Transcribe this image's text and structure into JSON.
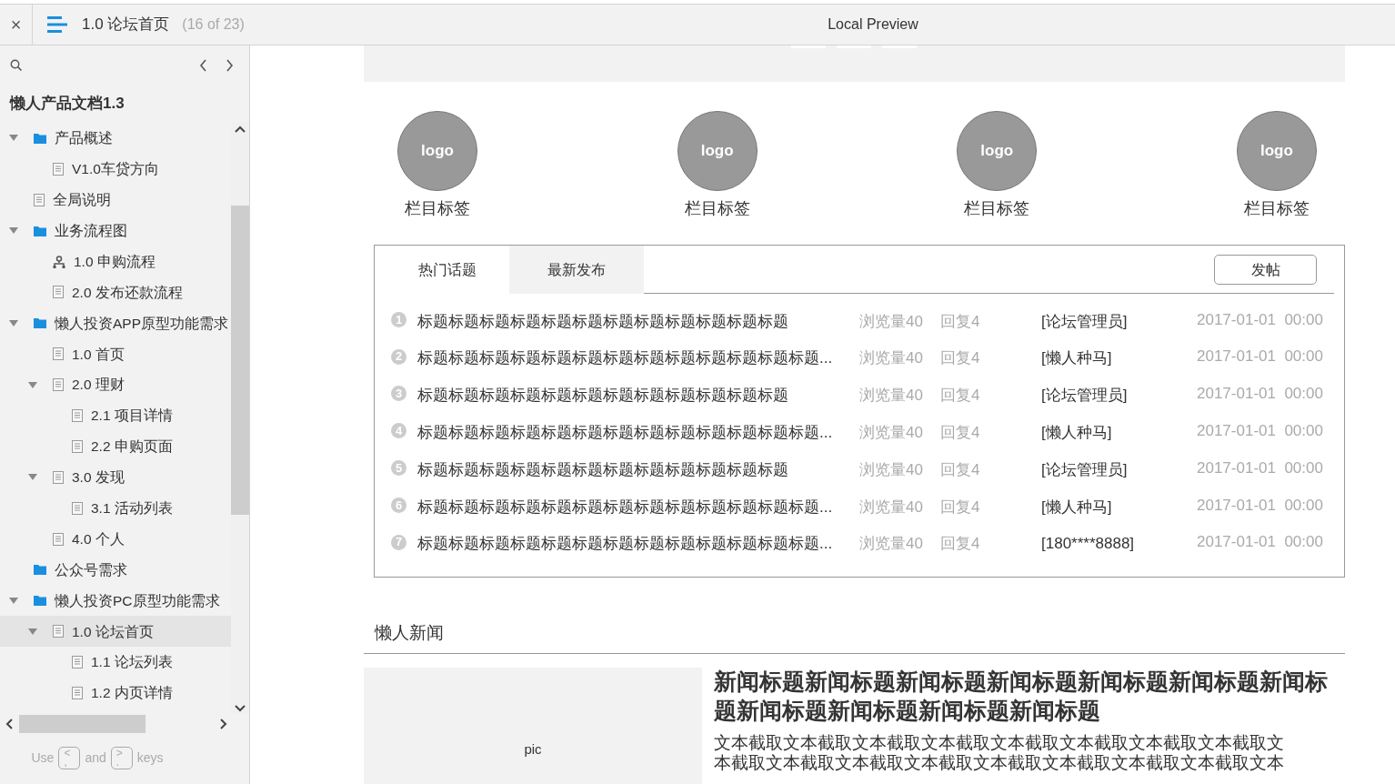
{
  "title_bar": {
    "close": "×",
    "page_title": "1.0 论坛首页",
    "page_count": "(16 of 23)",
    "preview_title": "Local Preview"
  },
  "sidebar": {
    "project_title": "懒人产品文档1.3",
    "items": [
      {
        "label": "产品概述",
        "kind": "folder",
        "expanded": true,
        "selected": false,
        "children": [
          {
            "label": "V1.0车贷方向",
            "kind": "page",
            "selected": false
          }
        ]
      },
      {
        "label": "全局说明",
        "kind": "page",
        "selected": false
      },
      {
        "label": "业务流程图",
        "kind": "folder",
        "expanded": true,
        "selected": false,
        "children": [
          {
            "label": "1.0 申购流程",
            "kind": "flow",
            "selected": false
          },
          {
            "label": "2.0 发布还款流程",
            "kind": "page",
            "selected": false
          }
        ]
      },
      {
        "label": "懒人投资APP原型功能需求",
        "kind": "folder",
        "expanded": true,
        "selected": false,
        "children": [
          {
            "label": "1.0 首页",
            "kind": "page",
            "selected": false
          },
          {
            "label": "2.0 理财",
            "kind": "page",
            "expanded": true,
            "selected": false,
            "children": [
              {
                "label": "2.1 项目详情",
                "kind": "page",
                "selected": false
              },
              {
                "label": "2.2 申购页面",
                "kind": "page",
                "selected": false
              }
            ]
          },
          {
            "label": "3.0 发现",
            "kind": "page",
            "expanded": true,
            "selected": false,
            "children": [
              {
                "label": "3.1 活动列表",
                "kind": "page",
                "selected": false
              }
            ]
          },
          {
            "label": "4.0 个人",
            "kind": "page",
            "selected": false
          }
        ]
      },
      {
        "label": "公众号需求",
        "kind": "folder",
        "selected": false
      },
      {
        "label": "懒人投资PC原型功能需求",
        "kind": "folder",
        "expanded": true,
        "selected": false,
        "children": [
          {
            "label": "1.0 论坛首页",
            "kind": "page",
            "expanded": true,
            "selected": true,
            "children": [
              {
                "label": "1.1 论坛列表",
                "kind": "page",
                "selected": false
              },
              {
                "label": "1.2 内页详情",
                "kind": "page",
                "selected": false
              }
            ]
          }
        ]
      }
    ],
    "footer": {
      "use": "Use",
      "key_prev": [
        "<",
        ","
      ],
      "and": "and",
      "key_next": [
        ">",
        "."
      ],
      "keys": "keys"
    }
  },
  "categories": [
    {
      "logo": "logo",
      "label": "栏目标签"
    },
    {
      "logo": "logo",
      "label": "栏目标签"
    },
    {
      "logo": "logo",
      "label": "栏目标签"
    },
    {
      "logo": "logo",
      "label": "栏目标签"
    }
  ],
  "forum": {
    "tabs": [
      {
        "label": "热门话题",
        "selected": false
      },
      {
        "label": "最新发布",
        "selected": true
      }
    ],
    "post_button": "发帖",
    "rows": [
      {
        "number": "1",
        "title": "标题标题标题标题标题标题标题标题标题标题标题标题",
        "views": "浏览量40",
        "replies": "回复4",
        "author": "[论坛管理员]",
        "time": "2017-01-01  00:00"
      },
      {
        "number": "2",
        "title": "标题标题标题标题标题标题标题标题标题标题标题标题标题...",
        "views": "浏览量40",
        "replies": "回复4",
        "author": "[懒人种马]",
        "time": "2017-01-01  00:00"
      },
      {
        "number": "3",
        "title": "标题标题标题标题标题标题标题标题标题标题标题标题",
        "views": "浏览量40",
        "replies": "回复4",
        "author": "[论坛管理员]",
        "time": "2017-01-01  00:00"
      },
      {
        "number": "4",
        "title": "标题标题标题标题标题标题标题标题标题标题标题标题标题...",
        "views": "浏览量40",
        "replies": "回复4",
        "author": "[懒人种马]",
        "time": "2017-01-01  00:00"
      },
      {
        "number": "5",
        "title": "标题标题标题标题标题标题标题标题标题标题标题标题",
        "views": "浏览量40",
        "replies": "回复4",
        "author": "[论坛管理员]",
        "time": "2017-01-01  00:00"
      },
      {
        "number": "6",
        "title": "标题标题标题标题标题标题标题标题标题标题标题标题标题...",
        "views": "浏览量40",
        "replies": "回复4",
        "author": "[懒人种马]",
        "time": "2017-01-01  00:00"
      },
      {
        "number": "7",
        "title": "标题标题标题标题标题标题标题标题标题标题标题标题标题...",
        "views": "浏览量40",
        "replies": "回复4",
        "author": "[180****8888]",
        "time": "2017-01-01  00:00"
      }
    ]
  },
  "news": {
    "heading": "懒人新闻",
    "items": [
      {
        "pic_label": "pic",
        "title": "新闻标题新闻标题新闻标题新闻标题新闻标题新闻标题新闻标题新闻标题新闻标题新闻标题新闻标题",
        "excerpt": "文本截取文本截取文本截取文本截取文本截取文本截取文本截取文本截取文本截取文本截取文本截取文本截取文本截取文本截取文本截取文本截取文本"
      }
    ]
  }
}
